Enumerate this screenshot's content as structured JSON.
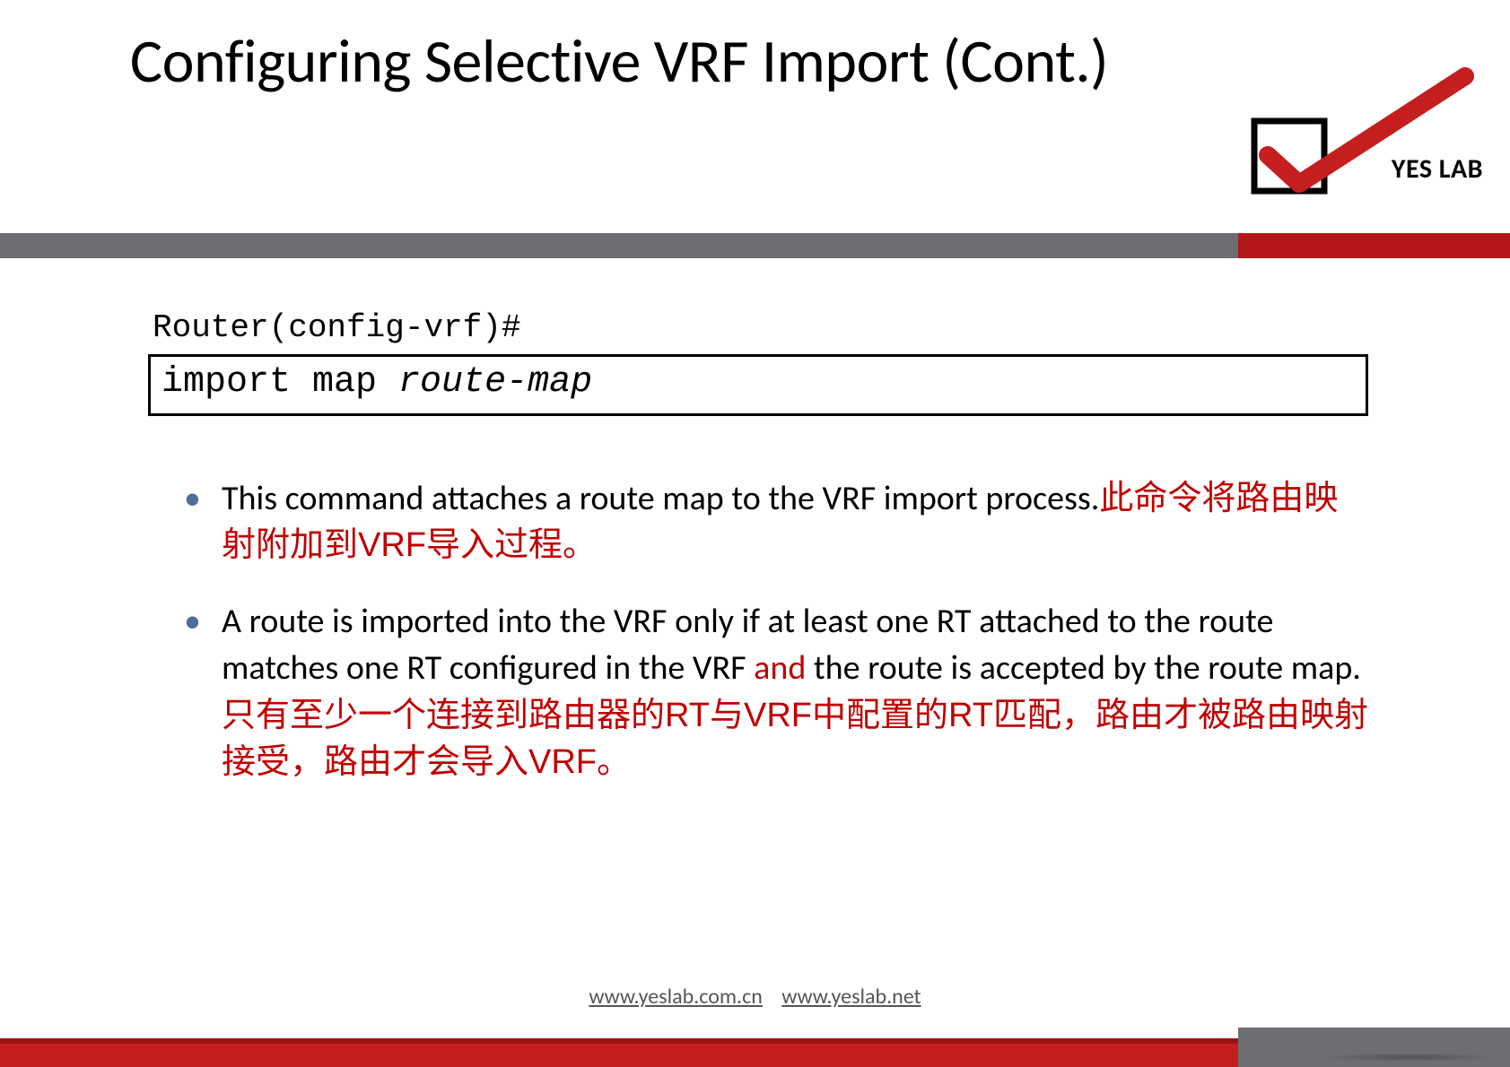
{
  "title": "Configuring Selective VRF Import (Cont.)",
  "logo": {
    "text": "YES LAB"
  },
  "prompt": "Router(config-vrf)#",
  "command": {
    "text": "import map ",
    "argument": "route-map"
  },
  "bullets": [
    {
      "english": "This command attaches a route map to the VRF import process.",
      "chinese": "此命令将路由映射附加到VRF导入过程。"
    },
    {
      "english_before": "A route is imported into the VRF only if at least one RT attached to the route matches one RT configured in the VRF ",
      "red_word": "and",
      "english_after": " the route is accepted by the route map.",
      "chinese": "只有至少一个连接到路由器的RT与VRF中配置的RT匹配，路由才被路由映射接受，路由才会导入VRF。"
    }
  ],
  "footer": {
    "link1": {
      "text": "www.yeslab.com.cn",
      "href": "http://www.yeslab.com.cn"
    },
    "link2": {
      "text": "www.yeslab.net",
      "href": "http://www.yeslab.net"
    }
  }
}
